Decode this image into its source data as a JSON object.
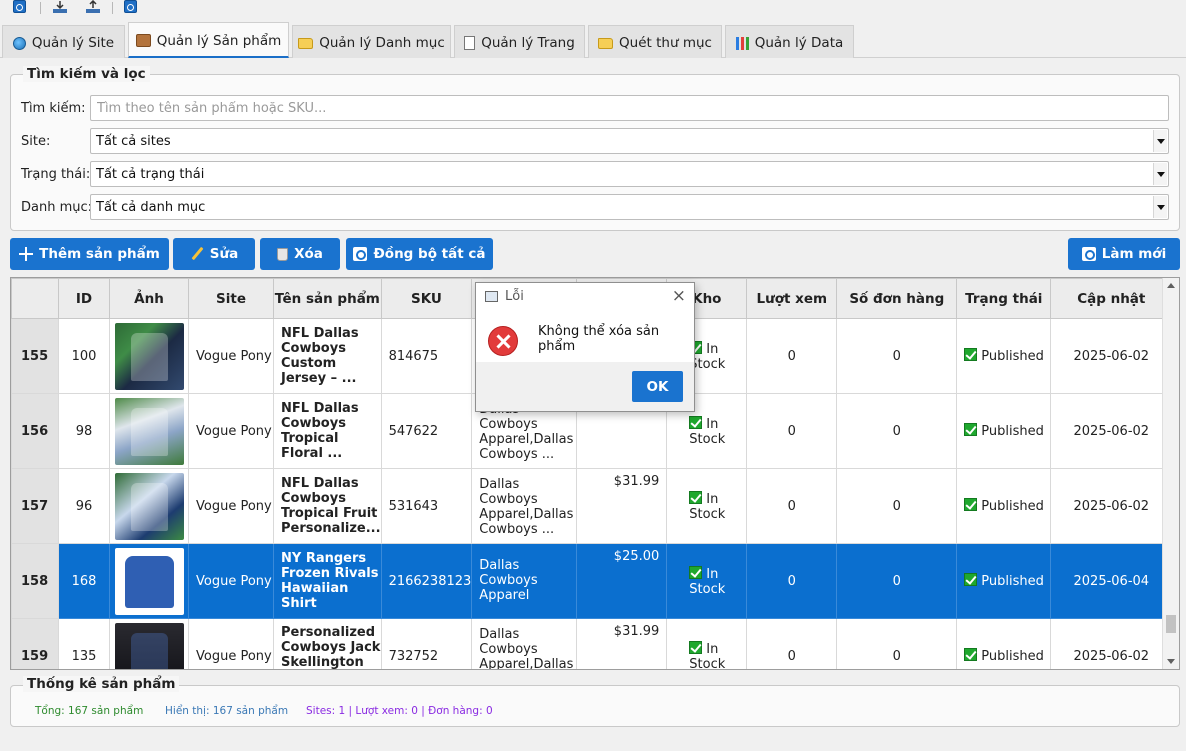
{
  "toolbar": {
    "icons": [
      "sync-icon",
      "import-icon",
      "export-icon",
      "refresh-icon"
    ]
  },
  "tabs": [
    {
      "label": "Quản lý Site",
      "icon": "globe-icon"
    },
    {
      "label": "Quản lý Sản phẩm",
      "icon": "box-icon",
      "active": true
    },
    {
      "label": "Quản lý Danh mục",
      "icon": "folder-icon"
    },
    {
      "label": "Quản lý Trang",
      "icon": "page-icon"
    },
    {
      "label": "Quét thư mục",
      "icon": "folder-icon"
    },
    {
      "label": "Quản lý Data",
      "icon": "chart-icon"
    }
  ],
  "filter": {
    "legend": "Tìm kiếm và lọc",
    "search_label": "Tìm kiếm:",
    "search_placeholder": "Tìm theo tên sản phẩm hoặc SKU...",
    "search_value": "",
    "site_label": "Site:",
    "site_value": "Tất cả sites",
    "status_label": "Trạng thái:",
    "status_value": "Tất cả trạng thái",
    "category_label": "Danh mục:",
    "category_value": "Tất cả danh mục"
  },
  "actions": {
    "add": "Thêm sản phẩm",
    "edit": "Sửa",
    "delete": "Xóa",
    "sync_all": "Đồng bộ tất cả",
    "refresh": "Làm mới"
  },
  "table": {
    "columns": [
      "",
      "ID",
      "Ảnh",
      "Site",
      "Tên sản phẩm",
      "SKU",
      "",
      "",
      "Kho",
      "Lượt xem",
      "Số đơn hàng",
      "Trạng thái",
      "Cập nhật"
    ],
    "rows": [
      {
        "row": "155",
        "id": "100",
        "site": "Vogue Pony",
        "name": "NFL Dallas Cowboys Custom Jersey – ...",
        "name_lines": [
          "NFL Dallas",
          "Cowboys",
          "Custom",
          "Jersey – ..."
        ],
        "sku": "814675",
        "cat_lines": [
          "D",
          "C",
          "A",
          "C"
        ],
        "price": "",
        "stock_lines": [
          "In",
          "Stock"
        ],
        "views": "0",
        "orders": "0",
        "status": "Published",
        "updated": "2025-06-02"
      },
      {
        "row": "156",
        "id": "98",
        "site": "Vogue Pony",
        "name": "NFL Dallas Cowboys Tropical Floral ...",
        "name_lines": [
          "NFL Dallas",
          "Cowboys",
          "Tropical",
          "Floral ..."
        ],
        "sku": "547622",
        "cat_lines": [
          "Dallas",
          "Cowboys",
          "Apparel,Dallas",
          "Cowboys ..."
        ],
        "price": "",
        "stock_lines": [
          "In",
          "Stock"
        ],
        "views": "0",
        "orders": "0",
        "status": "Published",
        "updated": "2025-06-02"
      },
      {
        "row": "157",
        "id": "96",
        "site": "Vogue Pony",
        "name": "NFL Dallas Cowboys Tropical Fruit Personalize...",
        "name_lines": [
          "NFL Dallas",
          "Cowboys",
          "Tropical Fruit",
          "Personalize..."
        ],
        "sku": "531643",
        "cat_lines": [
          "Dallas",
          "Cowboys",
          "Apparel,Dallas",
          "Cowboys ..."
        ],
        "price": "$31.99",
        "stock_lines": [
          "In",
          "Stock"
        ],
        "views": "0",
        "orders": "0",
        "status": "Published",
        "updated": "2025-06-02"
      },
      {
        "row": "158",
        "id": "168",
        "site": "Vogue Pony",
        "name": "NY Rangers Frozen Rivals Hawaiian Shirt",
        "name_lines": [
          "NY Rangers",
          "Frozen Rivals",
          "Hawaiian",
          "Shirt"
        ],
        "sku": "2166238123",
        "cat_lines": [
          "Dallas",
          "Cowboys",
          "Apparel"
        ],
        "price": "$25.00",
        "stock_lines": [
          "In",
          "Stock"
        ],
        "views": "0",
        "orders": "0",
        "status": "Published",
        "updated": "2025-06-04",
        "selected": true
      },
      {
        "row": "159",
        "id": "135",
        "site": "Vogue Pony",
        "name": "Personalized Cowboys Jack Skellington",
        "name_lines": [
          "Personalized",
          "Cowboys Jack",
          "Skellington"
        ],
        "sku": "732752",
        "cat_lines": [
          "Dallas",
          "Cowboys",
          "Apparel,Dallas"
        ],
        "price": "$31.99",
        "stock_lines": [
          "In",
          "Stock"
        ],
        "views": "0",
        "orders": "0",
        "status": "Published",
        "updated": "2025-06-02"
      }
    ]
  },
  "dialog": {
    "title": "Lỗi",
    "message": "Không thể xóa sản phẩm",
    "ok": "OK",
    "close": "×"
  },
  "stats": {
    "legend": "Thống kê sản phẩm",
    "total": "Tổng: 167 sản phẩm",
    "shown": "Hiển thị: 167 sản phẩm",
    "sites": "Sites: 1 | Lượt xem: 0 | Đơn hàng: 0",
    "total_color": "#2e8b2e",
    "shown_color": "#3a78b5",
    "sites_color": "#8a2be2"
  }
}
